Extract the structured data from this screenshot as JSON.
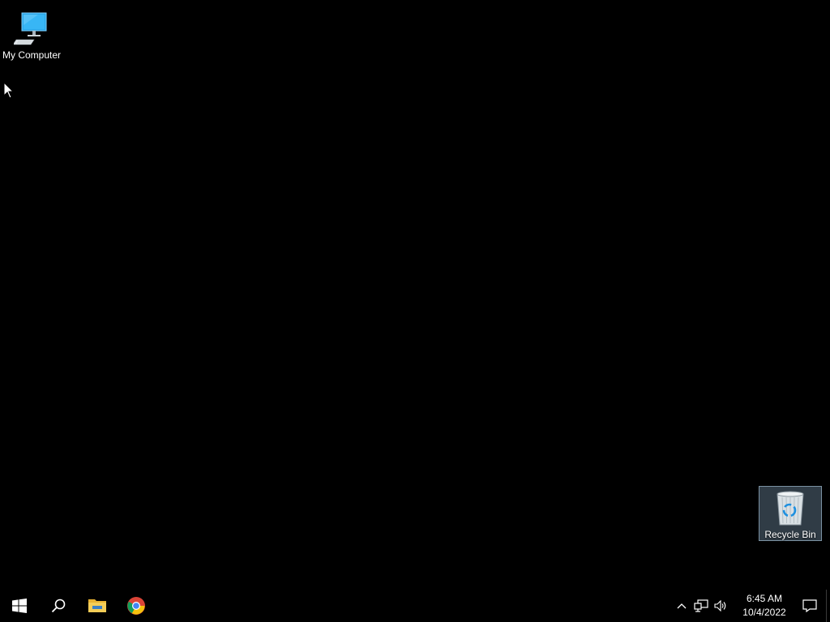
{
  "desktop": {
    "background_color": "#000000",
    "icons": {
      "my_computer": {
        "label": "My Computer",
        "icon": "computer-icon"
      },
      "recycle_bin": {
        "label": "Recycle Bin",
        "icon": "recycle-bin-icon",
        "selected": true
      }
    }
  },
  "taskbar": {
    "background_color": "#000000",
    "buttons": {
      "start": {
        "icon": "windows-logo-icon"
      },
      "search": {
        "icon": "search-icon"
      },
      "file_explorer": {
        "icon": "folder-icon"
      },
      "chrome": {
        "icon": "chrome-icon"
      }
    },
    "tray": {
      "overflow_icon": "chevron-up-icon",
      "network_icon": "network-icon",
      "volume_icon": "volume-icon",
      "time": "6:45 AM",
      "date": "10/4/2022",
      "notification_icon": "action-center-icon"
    }
  },
  "colors": {
    "accent_blue": "#1ba1e2",
    "folder_yellow": "#f0c33c"
  }
}
